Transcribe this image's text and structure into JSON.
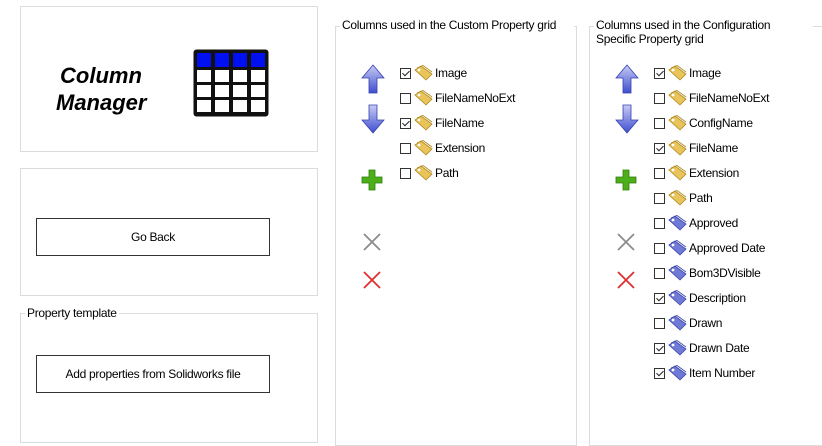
{
  "logo": {
    "line1": "Column",
    "line2": "Manager",
    "icon": "table-grid-icon",
    "accent": "#0000ff"
  },
  "go_back_button": {
    "label": "Go Back"
  },
  "property_template": {
    "legend": "Property template",
    "add_button_label": "Add properties from Solidworks file"
  },
  "custom_grid": {
    "legend": "Columns used in the Custom Property grid",
    "items": [
      {
        "label": "Image",
        "checked": true,
        "icon": "yellow-tag-icon"
      },
      {
        "label": "FileNameNoExt",
        "checked": false,
        "icon": "yellow-tag-icon"
      },
      {
        "label": "FileName",
        "checked": true,
        "icon": "yellow-tag-icon"
      },
      {
        "label": "Extension",
        "checked": false,
        "icon": "yellow-tag-icon"
      },
      {
        "label": "Path",
        "checked": false,
        "icon": "yellow-tag-icon"
      }
    ]
  },
  "config_grid": {
    "legend": "Columns used in the Configuration Specific Property grid",
    "items": [
      {
        "label": "Image",
        "checked": true,
        "icon": "yellow-tag-icon"
      },
      {
        "label": "FileNameNoExt",
        "checked": false,
        "icon": "yellow-tag-icon"
      },
      {
        "label": "ConfigName",
        "checked": false,
        "icon": "yellow-tag-icon"
      },
      {
        "label": "FileName",
        "checked": true,
        "icon": "yellow-tag-icon"
      },
      {
        "label": "Extension",
        "checked": false,
        "icon": "yellow-tag-icon"
      },
      {
        "label": "Path",
        "checked": false,
        "icon": "yellow-tag-icon"
      },
      {
        "label": "Approved",
        "checked": false,
        "icon": "blue-tag-icon"
      },
      {
        "label": "Approved Date",
        "checked": false,
        "icon": "blue-tag-icon"
      },
      {
        "label": "Bom3DVisible",
        "checked": false,
        "icon": "blue-tag-icon"
      },
      {
        "label": "Description",
        "checked": true,
        "icon": "blue-tag-icon"
      },
      {
        "label": "Drawn",
        "checked": false,
        "icon": "blue-tag-icon"
      },
      {
        "label": "Drawn Date",
        "checked": true,
        "icon": "blue-tag-icon"
      },
      {
        "label": "Item Number",
        "checked": true,
        "icon": "blue-tag-icon"
      }
    ]
  },
  "colors": {
    "yellow_tag": "#e8c45a",
    "blue_tag": "#6f79d6",
    "arrow": "#5468d8",
    "plus": "#4caf1a",
    "delete": "#e03030",
    "clear": "#888888"
  }
}
